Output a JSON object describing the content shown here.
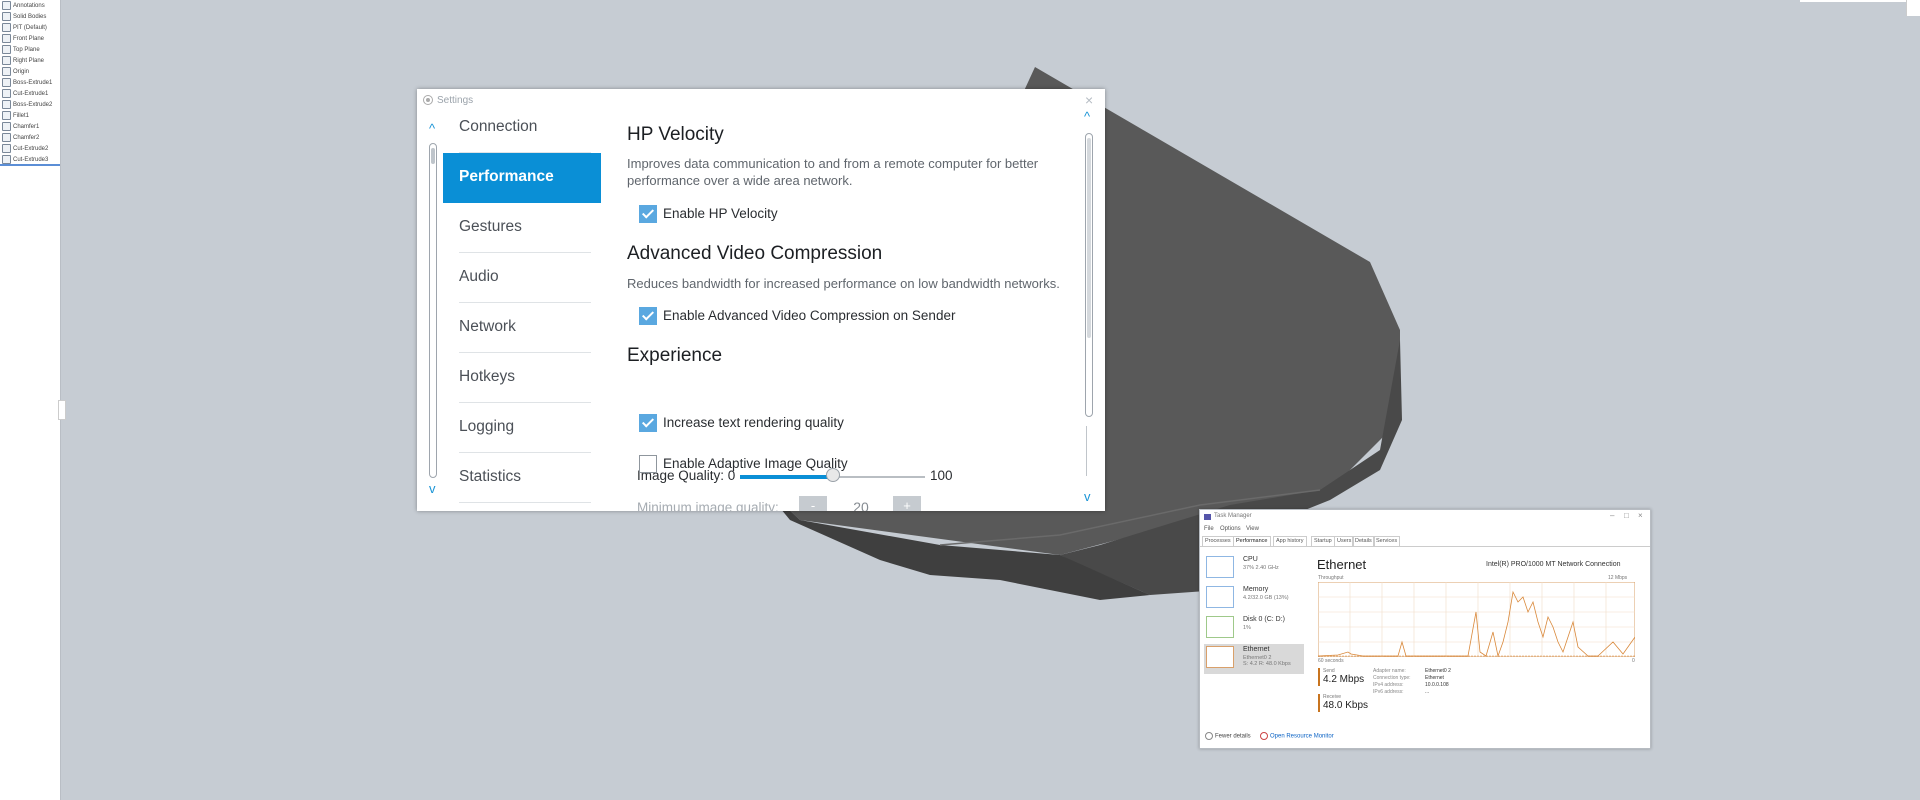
{
  "settings": {
    "title": "Settings",
    "close_glyph": "×",
    "nav": {
      "up_arrow": "^",
      "down_arrow": "v",
      "items": [
        {
          "label": "Connection"
        },
        {
          "label": "Performance",
          "active": true
        },
        {
          "label": "Gestures"
        },
        {
          "label": "Audio"
        },
        {
          "label": "Network"
        },
        {
          "label": "Hotkeys"
        },
        {
          "label": "Logging"
        },
        {
          "label": "Statistics"
        }
      ]
    },
    "hp_velocity": {
      "heading": "HP Velocity",
      "description": "Improves data communication to and from a remote computer for better performance over a wide area network.",
      "checkbox_label": "Enable HP Velocity",
      "checked": true
    },
    "avc": {
      "heading": "Advanced Video Compression",
      "description": "Reduces bandwidth for increased performance on low bandwidth networks.",
      "checkbox_label": "Enable Advanced Video Compression on Sender",
      "checked": true
    },
    "experience": {
      "heading": "Experience",
      "image_quality_label": "Image Quality: 0",
      "image_quality_max_label": "100",
      "image_quality_value": 50,
      "text_rendering_label": "Increase text rendering quality",
      "text_rendering_checked": true,
      "adaptive_label": "Enable Adaptive Image Quality",
      "adaptive_checked": false,
      "min_quality_label": "Minimum image quality:",
      "min_quality_value": "20",
      "minus": "-",
      "plus": "+"
    },
    "accent_color": "#0a8fd6"
  },
  "task_manager": {
    "title": "Task Manager",
    "menu": [
      "File",
      "Options",
      "View"
    ],
    "tabs": [
      "Processes",
      "Performance",
      "App history",
      "Startup",
      "Users",
      "Details",
      "Services"
    ],
    "active_tab": "Performance",
    "sidebar": [
      {
        "name": "CPU",
        "sub": "37% 2.40 GHz"
      },
      {
        "name": "Memory",
        "sub": "4.2/32.0 GB (13%)"
      },
      {
        "name": "Disk 0 (C: D:)",
        "sub": "1%"
      },
      {
        "name": "Ethernet",
        "sub": "Ethernet0 2",
        "sub2": "S: 4.2 R: 48.0 Kbps",
        "selected": true
      }
    ],
    "ethernet": {
      "title": "Ethernet",
      "adapter": "Intel(R) PRO/1000 MT Network Connection",
      "graph_label": "Throughput",
      "graph_max": "12 Mbps",
      "axis_left": "60 seconds",
      "axis_right": "0",
      "send_label": "Send",
      "send_value": "4.2 Mbps",
      "receive_label": "Receive",
      "receive_value": "48.0 Kbps",
      "props": [
        {
          "k": "Adapter name:",
          "v": "Ethernet0 2"
        },
        {
          "k": "Connection type:",
          "v": "Ethernet"
        },
        {
          "k": "IPv4 address:",
          "v": "10.0.0.108"
        },
        {
          "k": "IPv6 address:",
          "v": "..."
        }
      ],
      "graph_color": "#d9883a"
    },
    "footer_fewer": "Fewer details",
    "footer_link": "Open Resource Monitor"
  },
  "cad_tree": {
    "items": [
      "Annotations",
      "Solid Bodies",
      "PIT (Default)",
      "Front Plane",
      "Top Plane",
      "Right Plane",
      "Origin",
      "Boss-Extrude1",
      "Cut-Extrude1",
      "Boss-Extrude2",
      "Fillet1",
      "Chamfer1",
      "Chamfer2",
      "Cut-Extrude2",
      "Cut-Extrude3"
    ]
  }
}
